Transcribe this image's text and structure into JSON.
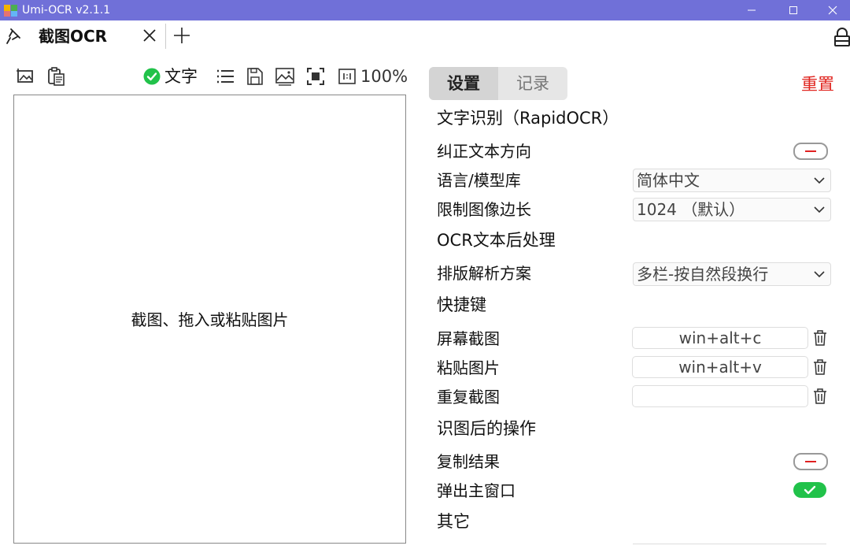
{
  "window": {
    "title": "Umi-OCR v2.1.1"
  },
  "tabs": {
    "active_label": "截图OCR"
  },
  "toolbar": {
    "text_mode_label": "文字",
    "zoom": "100%"
  },
  "canvas": {
    "hint": "截图、拖入或粘贴图片"
  },
  "settings": {
    "tab_settings": "设置",
    "tab_records": "记录",
    "reset_label": "重置",
    "ocr_section": "文字识别（RapidOCR）",
    "correct_direction_label": "纠正文本方向",
    "correct_direction_enabled": false,
    "language_label": "语言/模型库",
    "language_value": "简体中文",
    "limit_side_label": "限制图像边长",
    "limit_side_value": "1024 （默认）",
    "postprocess_section": "OCR文本后处理",
    "layout_label": "排版解析方案",
    "layout_value": "多栏-按自然段换行",
    "hotkey_section": "快捷键",
    "screenshot_label": "屏幕截图",
    "screenshot_key": "win+alt+c",
    "paste_label": "粘贴图片",
    "paste_key": "win+alt+v",
    "repeat_label": "重复截图",
    "repeat_key": "",
    "after_section": "识图后的操作",
    "copy_result_label": "复制结果",
    "copy_result_enabled": false,
    "popup_main_label": "弹出主窗口",
    "popup_main_enabled": true,
    "other_section": "其它"
  },
  "colors": {
    "titlebar": "#7070d8",
    "reset": "#e0241e",
    "toggle_on": "#21c24a",
    "check": "#21c24a"
  },
  "icons": [
    "app-icon",
    "minimize-icon",
    "maximize-icon",
    "close-icon",
    "pin-icon",
    "tab-close-icon",
    "add-tab-icon",
    "lock-icon",
    "screenshot-icon",
    "paste-icon",
    "check-icon",
    "list-icon",
    "save-icon",
    "image-icon",
    "fit-icon",
    "actual-size-icon",
    "chevron-down-icon",
    "trash-icon"
  ]
}
